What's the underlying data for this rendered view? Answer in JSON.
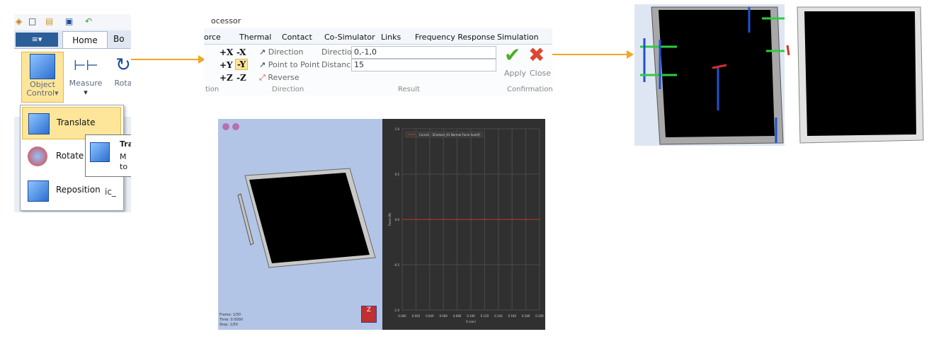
{
  "panel_a": {
    "toolbar_icons": [
      "app-icon",
      "new-file-icon",
      "open-folder-icon",
      "save-icon",
      "undo-icon"
    ],
    "file_button": "≡▾",
    "tabs": [
      "Home",
      "Bo"
    ],
    "ribbon_buttons": {
      "object_control": "Object Control",
      "object_control_arrow": "▾",
      "measure": "Measure",
      "measure_arrow": "▾",
      "rotate_partial": "Rota"
    },
    "menu": {
      "items": [
        "Translate",
        "Rotate",
        "Reposition"
      ],
      "selected": "Translate",
      "side_text": "ic_"
    },
    "tooltip": {
      "line1": "Tra",
      "line2": "M",
      "line3": "to"
    },
    "colors": {
      "highlight": "#fde59a",
      "file_button": "#2c5e9a"
    }
  },
  "panel_b": {
    "title": "ocessor",
    "tabs": [
      "orce",
      "Thermal",
      "Contact",
      "Co-Simulator",
      "Links",
      "Frequency Response",
      "Simulation"
    ],
    "axis_buttons": [
      "+X",
      "-X",
      "+Y",
      "-Y",
      "+Z",
      "-Z"
    ],
    "selected_axis": "-Y",
    "direction_buttons": [
      "Direction",
      "Point to Point",
      "Reverse"
    ],
    "direction_group_label": "Direction",
    "left_group_label": "tion",
    "result": {
      "direction_label": "Direction",
      "direction_value": "0,-1,0",
      "distance_label": "Distance",
      "distance_value": "15",
      "group_label": "Result"
    },
    "confirmation": {
      "apply": "Apply",
      "close": "Close",
      "group_label": "Confirmation"
    }
  },
  "panel_c": {
    "viewport_footer": [
      "Frame: 1/50",
      "Time: 0.0000",
      "Step: 1/50"
    ],
    "view_cube_label": "Z",
    "chart_data": {
      "type": "line",
      "series": [
        {
          "name": "Curve1 : 3Contact_01 Normal Force Sum(f)",
          "color": "#c0392b",
          "x": [
            0.0,
            0.2
          ],
          "y": [
            0.0,
            0.0
          ]
        }
      ],
      "ylabel": "Force (N)",
      "xlabel": "X (sec)",
      "xlim": [
        0.0,
        0.2
      ],
      "ylim": [
        -1.0,
        1.0
      ],
      "yticks": [
        "1.0",
        "0.5",
        "0.0",
        "-0.5",
        "-1.0"
      ],
      "xticks": [
        "0.000",
        "0.020",
        "0.040",
        "0.060",
        "0.080",
        "0.100",
        "0.120",
        "0.140",
        "0.160",
        "0.180",
        "0.200"
      ],
      "grid": true,
      "legend": "top-left"
    }
  },
  "arrows": {
    "color": "#f5a623"
  }
}
